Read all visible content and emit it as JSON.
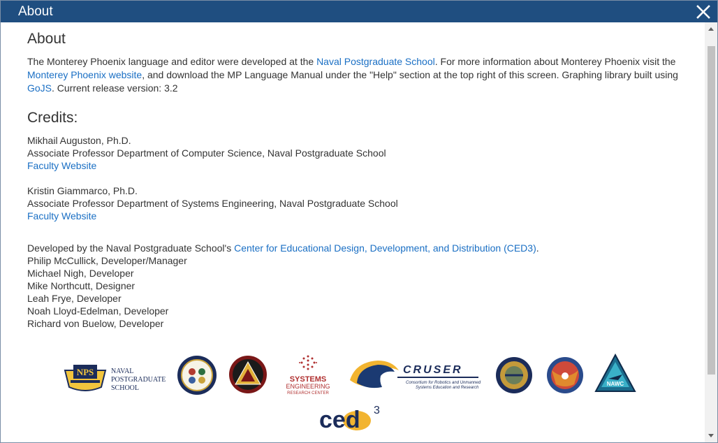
{
  "dialog": {
    "title": "About",
    "colors": {
      "titlebar": "#1f4e80",
      "link": "#1a6fc4"
    }
  },
  "about": {
    "heading": "About",
    "p1": "The Monterey Phoenix language and editor were developed at the ",
    "link_nps": "Naval Postgraduate School",
    "p2": ". For more information about Monterey Phoenix visit the",
    "link_mp": "Monterey Phoenix website",
    "p3": ", and download the MP Language Manual under the \"Help\" section at the top right of this screen. Graphing library built using",
    "link_gojs": "GoJS",
    "p4": ". Current release version: 3.2"
  },
  "credits": {
    "heading": "Credits:",
    "people": [
      {
        "name": "Mikhail Auguston, Ph.D.",
        "role": "Associate Professor Department of Computer Science, Naval Postgraduate School",
        "link": "Faculty Website"
      },
      {
        "name": "Kristin Giammarco, Ph.D.",
        "role": "Associate Professor Department of Systems Engineering, Naval Postgraduate School",
        "link": "Faculty Website"
      }
    ],
    "dev_intro": "Developed by the Naval Postgraduate School's ",
    "dev_link": "Center for Educational Design, Development, and Distribution (CED3)",
    "dev_end": ".",
    "team": [
      "Philip McCullick, Developer/Manager",
      "Michael Nigh, Developer",
      "Mike Northcutt, Designer",
      "Leah Frye, Developer",
      "Noah Lloyd-Edelman, Developer",
      "Richard von Buelow, Developer"
    ]
  },
  "logos": {
    "nps_text": [
      "NAVAL",
      "POSTGRADUATE",
      "SCHOOL"
    ],
    "nps_badge": "NPS",
    "ser_text": [
      "SYSTEMS",
      "ENGINEERING",
      "RESEARCH CENTER"
    ],
    "cruser_title": "CRUSER",
    "cruser_sub": [
      "Consortium for Robotics and Unmanned",
      "Systems Education and Research"
    ],
    "nawc": "NAWC",
    "ced": "ced",
    "ced_sup": "3"
  }
}
